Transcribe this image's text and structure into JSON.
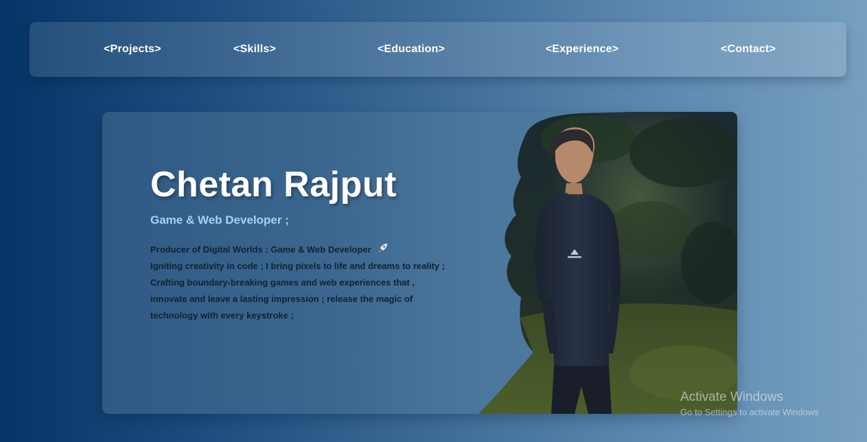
{
  "nav": {
    "items": [
      {
        "label": "<Projects>"
      },
      {
        "label": "<Skills>"
      },
      {
        "label": "<Education>"
      },
      {
        "label": "<Experience>"
      },
      {
        "label": "<Contact>"
      }
    ]
  },
  "hero": {
    "name": "Chetan Rajput",
    "role": "Game & Web Developer ;",
    "bio": [
      "Producer of Digital Worlds : Game & Web Developer",
      "Igniting creativity in code ; I bring pixels to life and dreams to reality ;",
      "Crafting boundary-breaking games and web experiences that ,",
      "innovate and leave a lasting impression ; release the magic of",
      "technology with every keystroke ;"
    ],
    "bio_emoji_icon": "rocket-icon"
  },
  "watermark": {
    "title": "Activate Windows",
    "subtitle": "Go to Settings to activate Windows"
  },
  "colors": {
    "background_start": "#053466",
    "background_end": "#77a0bf",
    "role_text": "#a9cff7",
    "bio_text": "#0f2233"
  }
}
